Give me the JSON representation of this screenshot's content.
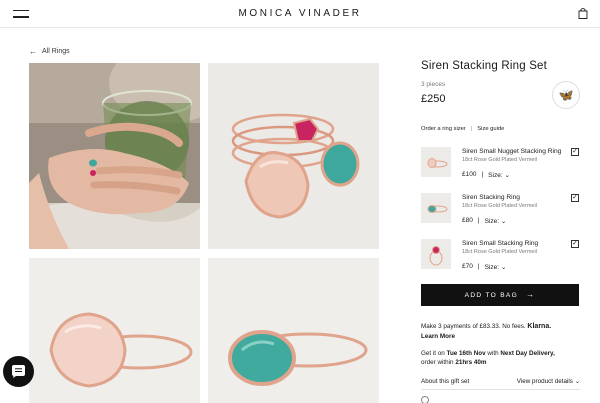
{
  "header": {
    "logo": "MONICA VINADER"
  },
  "breadcrumb": {
    "label": "All Rings"
  },
  "product": {
    "title": "Siren Stacking Ring Set",
    "pieces": "3 pieces",
    "price": "£250",
    "links": {
      "sizer": "Order a ring sizer",
      "separator": "|",
      "guide": "Size guide"
    },
    "items": [
      {
        "name": "Siren Small Nugget Stacking Ring",
        "material": "18ct Rose Gold Plated Vermeil",
        "price": "£100",
        "size_label": "Size:",
        "stone_color": "#e8c2b4",
        "checked": true
      },
      {
        "name": "Siren Stacking Ring",
        "material": "18ct Rose Gold Plated Vermeil",
        "price": "£80",
        "size_label": "Size:",
        "stone_color": "#3fa89c",
        "checked": true
      },
      {
        "name": "Siren Small Stacking Ring",
        "material": "18ct Rose Gold Plated Vermeil",
        "price": "£70",
        "size_label": "Size:",
        "stone_color": "#c8245f",
        "checked": true
      }
    ],
    "price_separator": "|",
    "add_to_bag": "ADD TO BAG"
  },
  "klarna": {
    "text": "Make 3 payments of £83.33. No fees.",
    "brand": "Klarna.",
    "learn_more": "Learn More"
  },
  "delivery": {
    "prefix": "Get it on",
    "date": "Tue 16th Nov",
    "mid": "with",
    "service": "Next Day Delivery,",
    "suffix": "order within",
    "countdown": "21hrs 40m"
  },
  "details": {
    "about": "About this gift set",
    "view": "View product details"
  },
  "colors": {
    "rose_gold": "#e0a48c",
    "accent_pink": "#d0306a",
    "amazonite": "#3fa89c",
    "button": "#111111"
  }
}
